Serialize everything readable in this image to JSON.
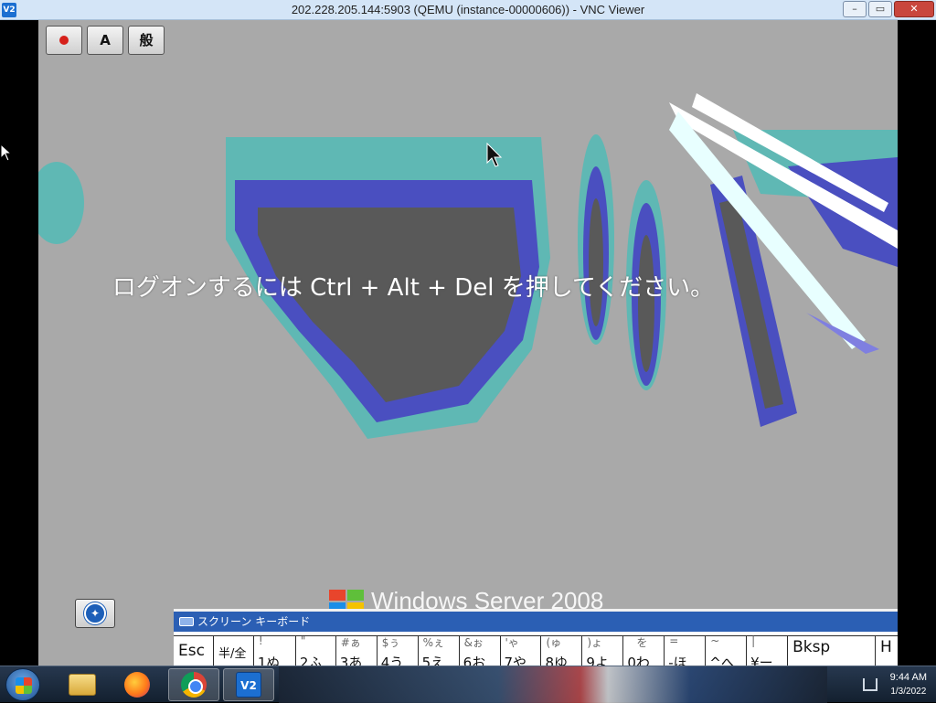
{
  "window": {
    "title": "202.228.205.144:5903 (QEMU (instance-00000606)) - VNC Viewer",
    "app_icon": "V2",
    "controls": {
      "minimize": "–",
      "maximize": "▭",
      "close": "✕"
    }
  },
  "toolbox": {
    "buttons": [
      {
        "name": "ime-toggle-button",
        "label": ""
      },
      {
        "name": "input-mode-button",
        "label": "A"
      },
      {
        "name": "dictionary-button",
        "label": "般"
      }
    ]
  },
  "login_screen": {
    "message": "ログオンするには Ctrl + Alt + Del を押してください。",
    "brand": "Windows Server 2008"
  },
  "onscreen_keyboard": {
    "title": "スクリーン キーボード",
    "keys": [
      {
        "main": "Esc",
        "top": "",
        "bottom": ""
      },
      {
        "main": "半/全",
        "top": "",
        "bottom": ""
      },
      {
        "main": "",
        "top": "!",
        "bottom": "1ぬ"
      },
      {
        "main": "",
        "top": "\"",
        "bottom": "2ふ"
      },
      {
        "main": "",
        "top": "#ぁ",
        "bottom": "3あ"
      },
      {
        "main": "",
        "top": "$ぅ",
        "bottom": "4う"
      },
      {
        "main": "",
        "top": "%ぇ",
        "bottom": "5え"
      },
      {
        "main": "",
        "top": "&ぉ",
        "bottom": "6お"
      },
      {
        "main": "",
        "top": "'ゃ",
        "bottom": "7や"
      },
      {
        "main": "",
        "top": "(ゅ",
        "bottom": "8ゆ"
      },
      {
        "main": "",
        "top": ")ょ",
        "bottom": "9よ"
      },
      {
        "main": "",
        "top": "を",
        "bottom": "0わ"
      },
      {
        "main": "",
        "top": "=",
        "bottom": "-ほ"
      },
      {
        "main": "",
        "top": "~",
        "bottom": "^へ"
      },
      {
        "main": "",
        "top": "|",
        "bottom": "¥ー"
      },
      {
        "main": "Bksp",
        "top": "",
        "bottom": ""
      },
      {
        "main": "H",
        "top": "",
        "bottom": ""
      }
    ]
  },
  "taskbar": {
    "items": [
      "folder-icon",
      "firefox-icon",
      "chrome-icon",
      "vnc-viewer-icon"
    ],
    "clock_time": "9:44 AM",
    "clock_date": "1/3/2022"
  }
}
